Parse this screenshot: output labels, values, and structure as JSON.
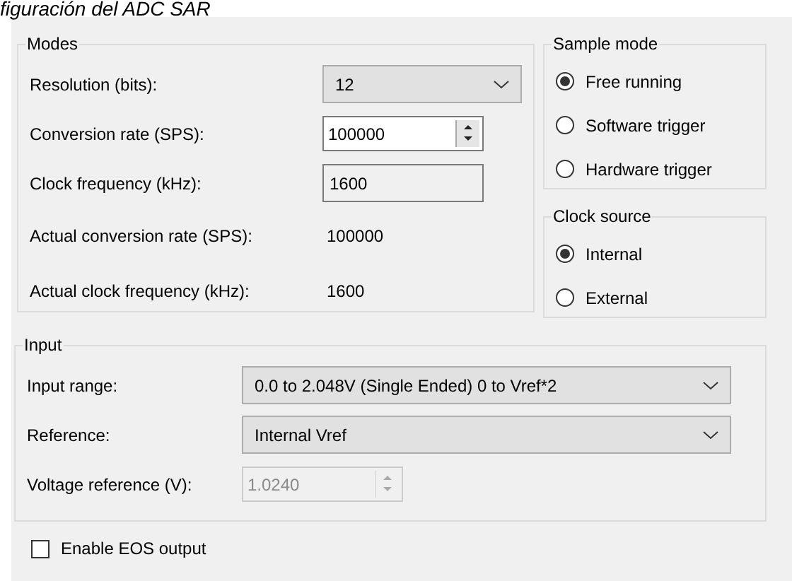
{
  "caption": "figuración del ADC SAR",
  "modes": {
    "title": "Modes",
    "fields": [
      {
        "label": "Resolution (bits):",
        "kind": "dropdown",
        "value": "12",
        "disabled": false
      },
      {
        "label": "Conversion rate (SPS):",
        "kind": "spinner",
        "value": "100000",
        "disabled": false
      },
      {
        "label": "Clock frequency (kHz):",
        "kind": "textbox",
        "value": "1600",
        "disabled": false
      },
      {
        "label": "Actual conversion rate (SPS):",
        "kind": "readout",
        "value": "100000",
        "disabled": false
      },
      {
        "label": "Actual clock frequency (kHz):",
        "kind": "readout",
        "value": "1600",
        "disabled": false
      }
    ]
  },
  "sample_mode": {
    "title": "Sample mode",
    "options": [
      {
        "label": "Free running",
        "selected": true
      },
      {
        "label": "Software trigger",
        "selected": false
      },
      {
        "label": "Hardware trigger",
        "selected": false
      }
    ]
  },
  "clock_source": {
    "title": "Clock source",
    "options": [
      {
        "label": "Internal",
        "selected": true
      },
      {
        "label": "External",
        "selected": false
      }
    ]
  },
  "input": {
    "title": "Input",
    "fields": [
      {
        "label": "Input range:",
        "kind": "dropdown",
        "value": "0.0 to 2.048V (Single Ended) 0 to Vref*2",
        "disabled": false
      },
      {
        "label": "Reference:",
        "kind": "dropdown",
        "value": "Internal Vref",
        "disabled": false
      },
      {
        "label": "Voltage reference (V):",
        "kind": "spinner",
        "value": "1.0240",
        "disabled": true
      }
    ]
  },
  "enable_eos": {
    "label": "Enable EOS output",
    "checked": false
  }
}
